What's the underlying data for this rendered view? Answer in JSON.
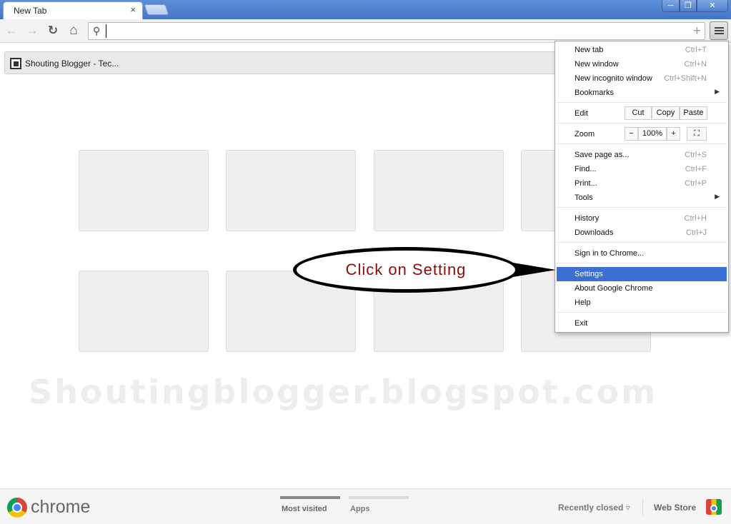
{
  "window": {
    "tab_title": "New Tab",
    "tab_close": "×",
    "min_label": "─",
    "max_label": "❐",
    "close_label": "✕"
  },
  "toolbar": {
    "back_icon": "←",
    "forward_icon": "→",
    "reload_icon": "↻",
    "home_icon": "⌂",
    "search_icon": "⚲",
    "omnibox_value": "",
    "star_icon": "+"
  },
  "bookmarks": [
    {
      "label": "Shouting Blogger - Tec..."
    }
  ],
  "watermark": "Shoutingblogger.blogspot.com",
  "bottombar": {
    "logo_text": "chrome",
    "tabs": [
      {
        "label": "Most visited"
      },
      {
        "label": "Apps"
      }
    ],
    "recently_closed": "Recently closed ▿",
    "web_store": "Web Store"
  },
  "menu": {
    "items": [
      {
        "label": "New tab",
        "shortcut": "Ctrl+T"
      },
      {
        "label": "New window",
        "shortcut": "Ctrl+N"
      },
      {
        "label": "New incognito window",
        "shortcut": "Ctrl+Shift+N"
      },
      {
        "label": "Bookmarks",
        "arrow": "▶"
      },
      {
        "label": "Edit"
      },
      {
        "label": "Zoom"
      },
      {
        "label": "Save page as...",
        "shortcut": "Ctrl+S"
      },
      {
        "label": "Find...",
        "shortcut": "Ctrl+F"
      },
      {
        "label": "Print...",
        "shortcut": "Ctrl+P"
      },
      {
        "label": "Tools",
        "arrow": "▶"
      },
      {
        "label": "History",
        "shortcut": "Ctrl+H"
      },
      {
        "label": "Downloads",
        "shortcut": "Ctrl+J"
      },
      {
        "label": "Sign in to Chrome..."
      },
      {
        "label": "Settings"
      },
      {
        "label": "About Google Chrome"
      },
      {
        "label": "Help"
      },
      {
        "label": "Exit"
      }
    ],
    "edit": {
      "cut": "Cut",
      "copy": "Copy",
      "paste": "Paste"
    },
    "zoom": {
      "minus": "−",
      "value": "100%",
      "plus": "+",
      "fullscreen": "⛶"
    },
    "highlight_color": "#3b6fd1"
  },
  "callout": {
    "text": "Click on Setting"
  }
}
